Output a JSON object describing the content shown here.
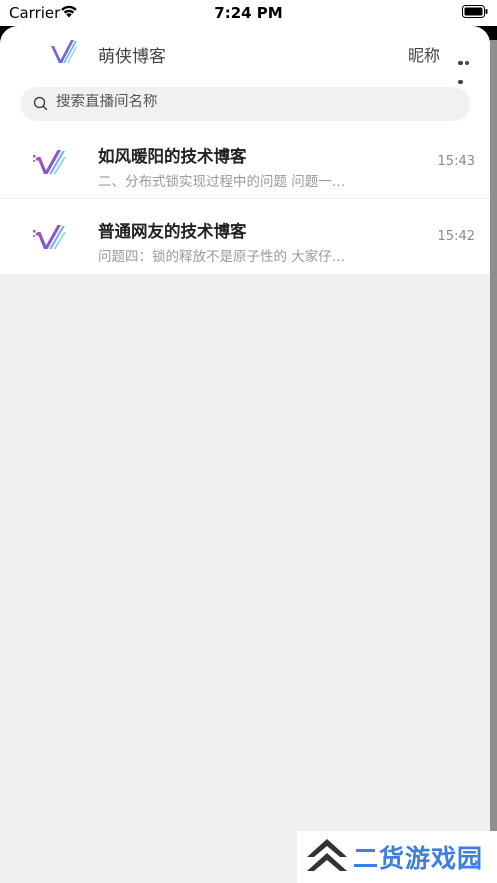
{
  "status_bar": {
    "carrier": "Carrier",
    "time": "7:24 PM"
  },
  "header": {
    "title": "萌侠博客",
    "nickname": "昵称",
    "more_icon": "more-dots-icon",
    "logo_icon": "v-logo-icon"
  },
  "search": {
    "placeholder": "搜索直播间名称",
    "icon": "search-icon"
  },
  "rooms": [
    {
      "title": "如风暖阳的技术博客",
      "preview": "二、分布式锁实现过程中的问题 问题一…",
      "time": "15:43"
    },
    {
      "title": "普通网友的技术博客",
      "preview": "问题四：锁的释放不是原子性的 大家仔…",
      "time": "15:42"
    }
  ],
  "watermark": {
    "text": "二货游戏园"
  },
  "colors": {
    "accent_purple": "#7b4fd6",
    "accent_blue": "#3d7fe0",
    "background": "#f0f0f0"
  }
}
